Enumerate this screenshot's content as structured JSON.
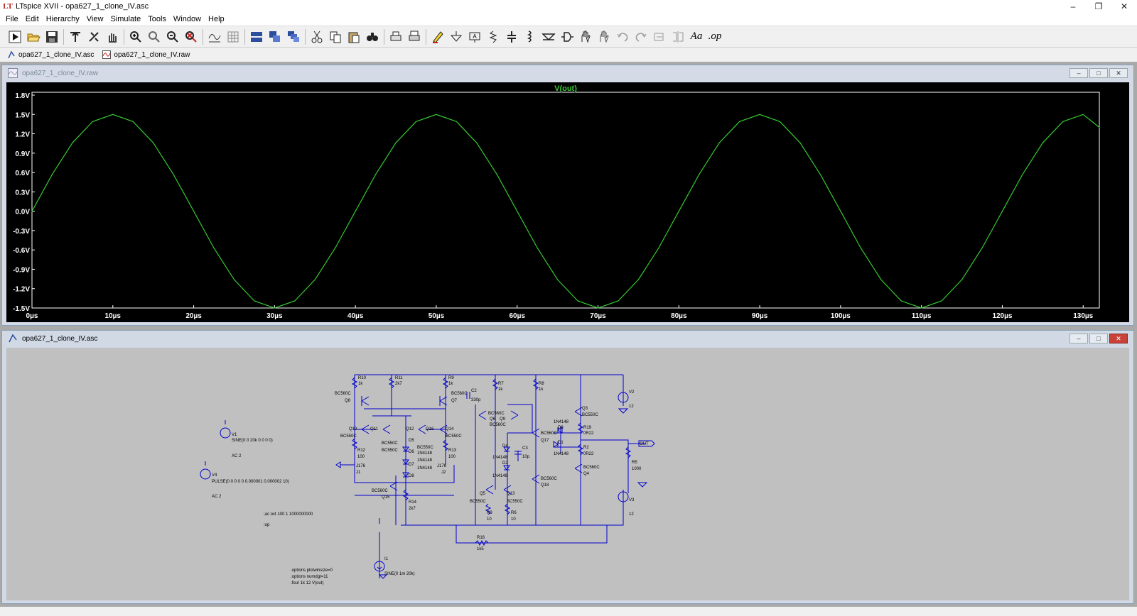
{
  "window": {
    "title": "LTspice XVII - opa627_1_clone_IV.asc",
    "controls": [
      "minimize",
      "restore",
      "close"
    ]
  },
  "menu": [
    "File",
    "Edit",
    "Hierarchy",
    "View",
    "Simulate",
    "Tools",
    "Window",
    "Help"
  ],
  "toolbar": {
    "buttons": [
      "run-icon",
      "open-icon",
      "save-icon",
      "control-panel-icon",
      "halt-icon",
      "pan-icon",
      "zoom-in-icon",
      "zoom-full-icon",
      "zoom-out-icon",
      "zoom-cancel-icon",
      "autorange-icon",
      "grid-icon",
      "tile-horizontal-icon",
      "tile-vertical-icon",
      "cascade-icon",
      "cut-icon",
      "copy-icon",
      "paste-icon",
      "find-icon",
      "print-icon",
      "print-setup-icon",
      "pencil-icon",
      "ground-icon",
      "label-icon",
      "resistor-icon",
      "capacitor-icon",
      "inductor-icon",
      "diode-icon",
      "component-icon",
      "move-icon",
      "drag-icon",
      "undo-icon",
      "redo-icon",
      "rotate-icon",
      "mirror-icon",
      "text-icon",
      "spice-directive-icon"
    ],
    "text_button": "Aa",
    "op_button": ".op"
  },
  "tabs": [
    {
      "label": "opa627_1_clone_IV.asc",
      "icon": "schematic-icon"
    },
    {
      "label": "opa627_1_clone_IV.raw",
      "icon": "waveform-icon"
    }
  ],
  "waveform_window": {
    "title": "opa627_1_clone_IV.raw",
    "trace_color": "#36c92f"
  },
  "chart_data": {
    "type": "line",
    "title": "V(out)",
    "xlabel": "",
    "ylabel": "",
    "x_ticks": [
      "0µs",
      "10µs",
      "20µs",
      "30µs",
      "40µs",
      "50µs",
      "60µs",
      "70µs",
      "80µs",
      "90µs",
      "100µs",
      "110µs",
      "120µs",
      "130µs"
    ],
    "y_ticks": [
      "1.8V",
      "1.5V",
      "1.2V",
      "0.9V",
      "0.6V",
      "0.3V",
      "0.0V",
      "-0.3V",
      "-0.6V",
      "-0.9V",
      "-1.2V",
      "-1.5V"
    ],
    "xlim": [
      0,
      132
    ],
    "ylim": [
      -1.5,
      1.8
    ],
    "x_unit": "µs",
    "series": [
      {
        "name": "V(out)",
        "x": [
          0,
          2.5,
          5,
          7.5,
          10,
          12.5,
          15,
          17.5,
          20,
          22.5,
          25,
          27.5,
          30,
          32.5,
          35,
          37.5,
          40,
          42.5,
          45,
          47.5,
          50,
          52.5,
          55,
          57.5,
          60,
          62.5,
          65,
          67.5,
          70,
          72.5,
          75,
          77.5,
          80,
          82.5,
          85,
          87.5,
          90,
          92.5,
          95,
          97.5,
          100,
          102.5,
          105,
          107.5,
          110,
          112.5,
          115,
          117.5,
          120,
          122.5,
          125,
          127.5,
          130,
          132
        ],
        "y": [
          0,
          0.57,
          1.06,
          1.39,
          1.5,
          1.39,
          1.06,
          0.57,
          0,
          -0.57,
          -1.06,
          -1.39,
          -1.5,
          -1.39,
          -1.06,
          -0.57,
          0,
          0.57,
          1.06,
          1.39,
          1.5,
          1.39,
          1.06,
          0.57,
          0,
          -0.57,
          -1.06,
          -1.39,
          -1.5,
          -1.39,
          -1.06,
          -0.57,
          0,
          0.57,
          1.06,
          1.39,
          1.5,
          1.39,
          1.06,
          0.57,
          0,
          -0.57,
          -1.06,
          -1.39,
          -1.5,
          -1.39,
          -1.06,
          -0.57,
          0,
          0.57,
          1.06,
          1.39,
          1.5,
          1.3
        ]
      }
    ],
    "grid": false,
    "background": "#000000",
    "axis_text_color": "#ffffff",
    "title_color": "#36c92f"
  },
  "schematic_window": {
    "title": "opa627_1_clone_IV.asc",
    "wire_color": "#0000cc",
    "labels": {
      "R10": "R10",
      "R10v": "1k",
      "R11": "R11",
      "R11v": "2k7",
      "R9": "R9",
      "R9v": "1k",
      "C2": "C2",
      "C2v": "330p",
      "R7": "R7",
      "R7v": "1k",
      "R8": "R8",
      "R8v": "1k",
      "V2": "V2",
      "V2v": "12",
      "Q3": "Q3",
      "Q3t": "BC550C",
      "Q8t": "BC560C",
      "Q8": "Q8",
      "Q7t": "BC560C",
      "Q7": "Q7",
      "Q6Q9t": "BC560C",
      "Q6": "Q6",
      "Q9": "Q9",
      "Q9t": "BC560C",
      "D3t": "1N4148",
      "D3": "D3",
      "R19": "R19",
      "R19v": "0R22",
      "Q10": "Q10",
      "Q10t": "BC550C",
      "Q11": "Q11",
      "Q12": "Q12",
      "Q16": "Q16",
      "Q14": "Q14",
      "Q14t": "BC550C",
      "Q11t": "BC550C",
      "Q12t": "BC550C",
      "Q16t": "BC550C",
      "D5": "D5",
      "D5t": "1N4148",
      "D4": "D4",
      "C3": "C3",
      "C3v": "10p",
      "Q17t": "BC560C",
      "Q17": "Q17",
      "D1": "D1",
      "D1t": "1N4148",
      "R2": "R2",
      "R2v": "0R22",
      "OUT": "OUT",
      "R5": "R5",
      "R5v": "1000",
      "R12": "R12",
      "R12v": "100",
      "R13": "R13",
      "R13v": "100",
      "D6": "D6",
      "D6t": "1N4148",
      "D7": "D7",
      "D7t": "1N4148",
      "D8": "D8",
      "D2t": "1N4148",
      "D2": "D2",
      "D4t": "1N4148",
      "J1t": "J176",
      "J1": "J1",
      "J2t": "J176",
      "J2": "J2",
      "Q18t": "BC560C",
      "Q18": "Q18",
      "Q4t": "BC560C",
      "Q4": "Q4",
      "Q15t": "BC560C",
      "Q15": "Q15",
      "R14": "R14",
      "R14v": "2k7",
      "Q5": "Q5",
      "Q5t": "BC550C",
      "Q13": "Q13",
      "Q13t": "BC550C",
      "R3": "R3",
      "R3v": "10",
      "R6": "R6",
      "R6v": "10",
      "V3": "V3",
      "V3v": "12",
      "R16": "R16",
      "R16v": "1k5",
      "V1": "V1",
      "V1v": "SINE(0 0 20k 0 0 0 0)",
      "V1ac": "AC 2",
      "V4": "V4",
      "V4v": "PULSE(0 0 0 0 0 0.000001 0.000002 10)",
      "V4ac": "AC 2",
      "I1": "I1",
      "I1v": "SINE(0 1m 20k)",
      "ac_dir": ";ac oct 100 1 1000000000",
      "op_dir": ";op",
      "opt1": ".options plotwinsize=0",
      "opt2": ".options numdgt=11",
      "four": ".four 1k 12 V(out)"
    }
  },
  "status": ""
}
